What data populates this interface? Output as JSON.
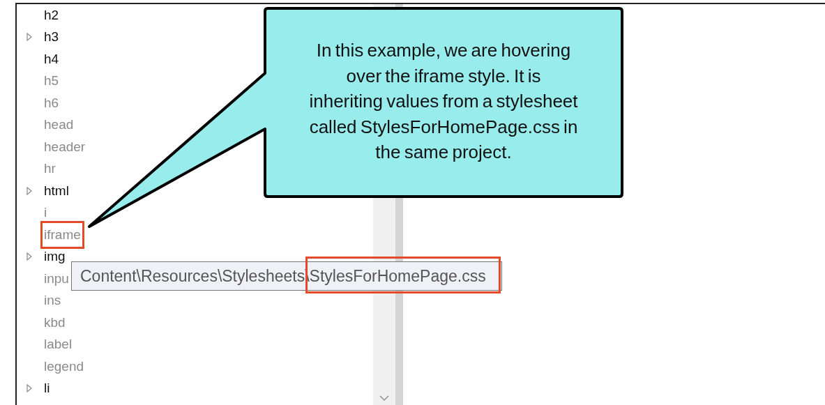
{
  "tree": {
    "items": [
      {
        "label": "h2",
        "kind": "plain",
        "dimmed": false,
        "highlighted": false
      },
      {
        "label": "h3",
        "kind": "expandable",
        "dimmed": false,
        "highlighted": false
      },
      {
        "label": "h4",
        "kind": "plain",
        "dimmed": false,
        "highlighted": false
      },
      {
        "label": "h5",
        "kind": "plain",
        "dimmed": true,
        "highlighted": false
      },
      {
        "label": "h6",
        "kind": "plain",
        "dimmed": true,
        "highlighted": false
      },
      {
        "label": "head",
        "kind": "plain",
        "dimmed": true,
        "highlighted": false
      },
      {
        "label": "header",
        "kind": "plain",
        "dimmed": true,
        "highlighted": false
      },
      {
        "label": "hr",
        "kind": "plain",
        "dimmed": true,
        "highlighted": false
      },
      {
        "label": "html",
        "kind": "expandable",
        "dimmed": false,
        "highlighted": false
      },
      {
        "label": "i",
        "kind": "plain",
        "dimmed": true,
        "highlighted": false
      },
      {
        "label": "iframe",
        "kind": "plain",
        "dimmed": true,
        "highlighted": true
      },
      {
        "label": "img",
        "kind": "expandable",
        "dimmed": false,
        "highlighted": false
      },
      {
        "label": "inpu",
        "kind": "plain",
        "dimmed": true,
        "highlighted": false
      },
      {
        "label": "ins",
        "kind": "plain",
        "dimmed": true,
        "highlighted": false
      },
      {
        "label": "kbd",
        "kind": "plain",
        "dimmed": true,
        "highlighted": false
      },
      {
        "label": "label",
        "kind": "plain",
        "dimmed": true,
        "highlighted": false
      },
      {
        "label": "legend",
        "kind": "plain",
        "dimmed": true,
        "highlighted": false
      },
      {
        "label": "li",
        "kind": "expandable",
        "dimmed": false,
        "highlighted": false
      }
    ]
  },
  "tooltip": {
    "text": "Content\\Resources\\Stylesheets\\StylesForHomePage.css"
  },
  "callout": {
    "text": "In this example, we are hovering\nover the iframe style. It is\ninheriting values from a stylesheet\ncalled StylesForHomePage.css in\nthe same project."
  }
}
